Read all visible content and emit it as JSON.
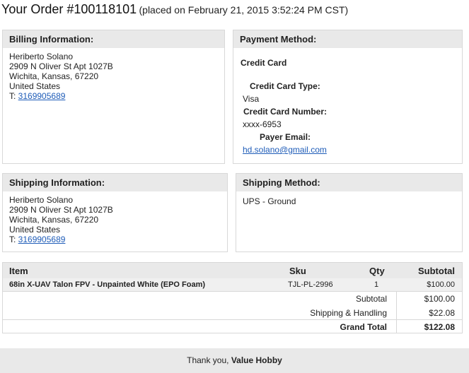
{
  "order": {
    "title": "Your Order #100118101",
    "placed": "(placed on February 21, 2015 3:52:24 PM CST)"
  },
  "billing": {
    "heading": "Billing Information:",
    "name": "Heriberto Solano",
    "street": "2909 N Oliver St Apt 1027B",
    "city": "Wichita, Kansas, 67220",
    "country": "United States",
    "phone_prefix": "T: ",
    "phone": "3169905689"
  },
  "payment": {
    "heading": "Payment Method:",
    "method": "Credit Card",
    "card_type_label": "Credit Card Type:",
    "card_type": "Visa",
    "card_number_label": "Credit Card Number:",
    "card_number": "xxxx-6953",
    "payer_email_label": "Payer Email:",
    "payer_email": "hd.solano@gmail.com"
  },
  "shipping": {
    "heading": "Shipping Information:",
    "name": "Heriberto Solano",
    "street": "2909 N Oliver St Apt 1027B",
    "city": "Wichita, Kansas, 67220",
    "country": "United States",
    "phone_prefix": "T: ",
    "phone": "3169905689"
  },
  "shipping_method": {
    "heading": "Shipping Method:",
    "value": "UPS - Ground"
  },
  "items": {
    "columns": {
      "item": "Item",
      "sku": "Sku",
      "qty": "Qty",
      "subtotal": "Subtotal"
    },
    "rows": [
      {
        "name": "68in X-UAV Talon FPV - Unpainted White (EPO Foam)",
        "sku": "TJL-PL-2996",
        "qty": "1",
        "subtotal": "$100.00"
      }
    ],
    "totals": {
      "subtotal_label": "Subtotal",
      "subtotal": "$100.00",
      "shipping_label": "Shipping & Handling",
      "shipping": "$22.08",
      "grand_label": "Grand Total",
      "grand": "$122.08"
    }
  },
  "footer": {
    "thanks": "Thank you, ",
    "store": "Value Hobby"
  }
}
